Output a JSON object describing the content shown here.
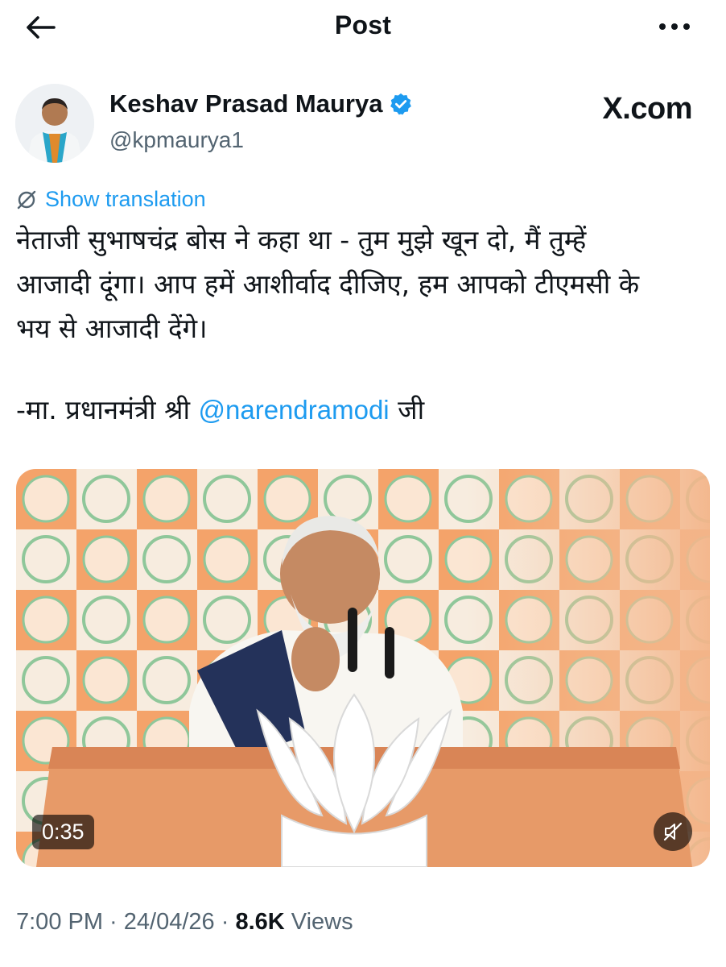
{
  "header": {
    "title": "Post",
    "back_icon": "back-arrow-icon",
    "more_icon": "more-dots-icon"
  },
  "author": {
    "name": "Keshav Prasad Maurya",
    "handle": "@kpmaurya1",
    "verified": true,
    "verified_color": "#1d9bf0"
  },
  "watermark": "X.com",
  "translation": {
    "label": "Show translation",
    "icon": "globe-translate-icon"
  },
  "tweet": {
    "text": "नेताजी सुभाषचंद्र बोस ने कहा था - तुम मुझे खून दो, मैं तुम्हें\nआजादी दूंगा। आप हमें आशीर्वाद दीजिए, हम आपको टीएमसी के\nभय से आजादी देंगे।",
    "sig_prefix": "-मा. प्रधानमंत्री श्री ",
    "mention": "@narendramodi",
    "sig_suffix": " जी"
  },
  "media": {
    "duration": "0:35",
    "muted": true,
    "mute_icon": "muted-speaker-icon"
  },
  "meta": {
    "time": "7:00 PM",
    "separator": " · ",
    "date": "24/04/26",
    "views_count": "8.6K",
    "views_label": " Views"
  },
  "colors": {
    "accent": "#1d9bf0",
    "text": "#0f1419",
    "secondary": "#536471"
  }
}
